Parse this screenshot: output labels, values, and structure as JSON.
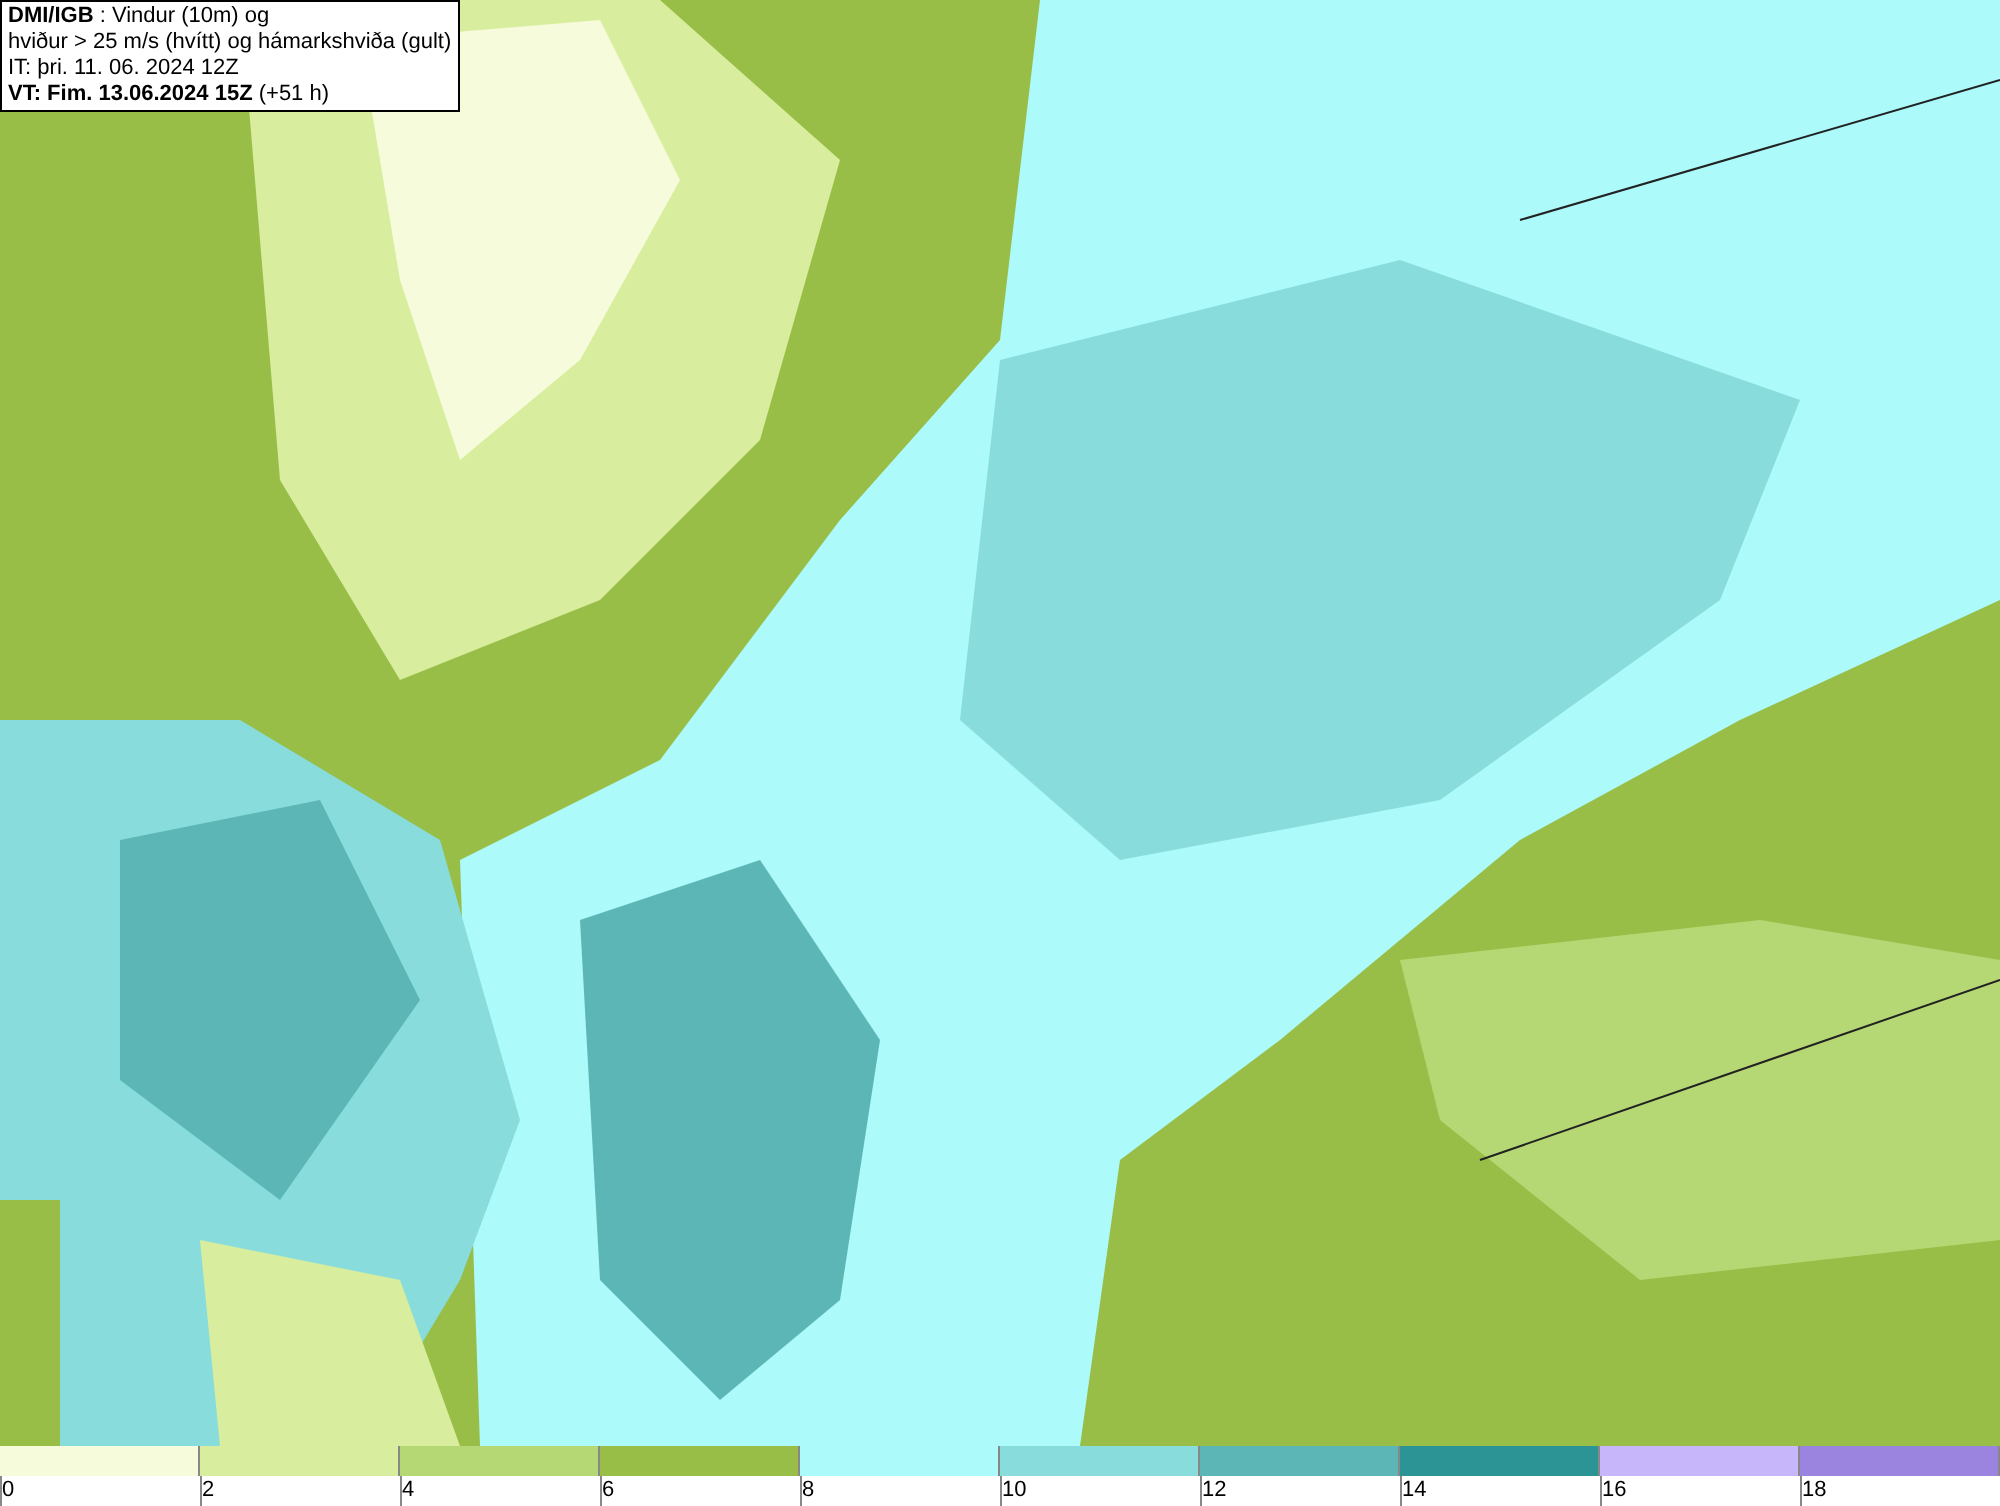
{
  "info_box": {
    "lines": [
      "**DMI/IGB** : Vindur (10m) og",
      "hviður > 25 m/s (hvítt) og hámarkshviða (gult)",
      "IT: þri. 11. 06. 2024 12Z",
      "**VT: Fim. 13.06.2024 15Z** (+51 h)"
    ]
  },
  "legend": [
    {
      "label": "0",
      "color": "#f6fbdc"
    },
    {
      "label": "2",
      "color": "#d8ee9e"
    },
    {
      "label": "4",
      "color": "#b6d874"
    },
    {
      "label": "6",
      "color": "#98be48"
    },
    {
      "label": "8",
      "color": "#adfafa"
    },
    {
      "label": "10",
      "color": "#88dcdc"
    },
    {
      "label": "12",
      "color": "#5cb6b6"
    },
    {
      "label": "14",
      "color": "#2c9494"
    },
    {
      "label": "16",
      "color": "#c8b6fa"
    },
    {
      "label": "18",
      "color": "#9a84e0"
    }
  ]
}
